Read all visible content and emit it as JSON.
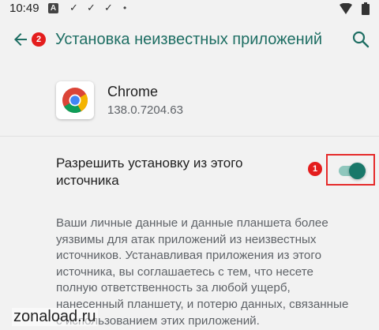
{
  "status_bar": {
    "time": "10:49",
    "notification_icons": [
      "a-app-icon",
      "check-icon",
      "check-icon",
      "check-icon",
      "dot-icon"
    ],
    "right_icons": [
      "wifi-icon",
      "battery-icon"
    ]
  },
  "app_bar": {
    "back_icon": "arrow-back-icon",
    "badge": "2",
    "title": "Установка неизвестных приложений",
    "search_icon": "search-icon"
  },
  "app_info": {
    "icon": "chrome-icon",
    "name": "Chrome",
    "version": "138.0.7204.63"
  },
  "setting": {
    "label": "Разрешить установку из этого источника",
    "badge": "1",
    "toggle_on": true
  },
  "description": "Ваши личные данные и данные планшета более уязвимы для атак приложений из неизвестных источников. Устанавливая приложения из этого источника, вы соглашаетесь с тем, что несете полную ответственность за любой ущерб, нанесенный планшету, и потерю данных, связанные с использованием этих приложений.",
  "watermark": "zonaload.ru",
  "colors": {
    "accent": "#1e6e63",
    "toggle_thumb": "#19786a",
    "toggle_track": "#8fc7bd",
    "badge": "#e41d1d"
  }
}
